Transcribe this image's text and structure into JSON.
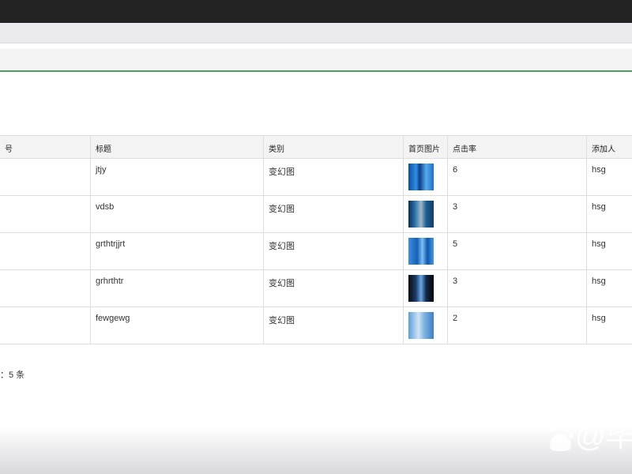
{
  "table": {
    "headers": [
      "号",
      "标题",
      "类别",
      "首页图片",
      "点击率",
      "添加人"
    ],
    "rows": [
      {
        "title": "jtjy",
        "category": "变幻图",
        "clicks": "6",
        "added_by": "hsg"
      },
      {
        "title": "vdsb",
        "category": "变幻图",
        "clicks": "3",
        "added_by": "hsg"
      },
      {
        "title": "grthtrjjrt",
        "category": "变幻图",
        "clicks": "5",
        "added_by": "hsg"
      },
      {
        "title": "grhrthtr",
        "category": "变幻图",
        "clicks": "3",
        "added_by": "hsg"
      },
      {
        "title": "fewgewg",
        "category": "变幻图",
        "clicks": "2",
        "added_by": "hsg"
      }
    ]
  },
  "footer": {
    "total_text": "：5 条"
  },
  "watermark": {
    "text": "@毕"
  }
}
